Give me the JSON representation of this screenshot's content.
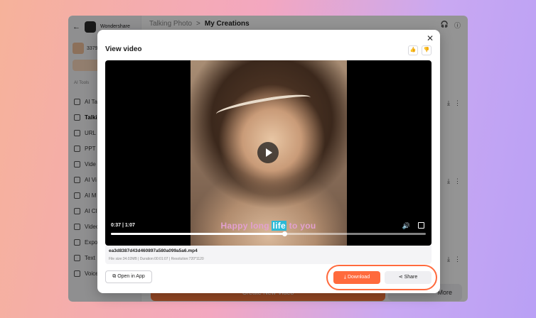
{
  "app": {
    "brand": "Wondershare",
    "credits": "3379",
    "sidebar_section": "AI Tools",
    "sidebar_items": [
      {
        "label": "AI Ta"
      },
      {
        "label": "Talki"
      },
      {
        "label": "URL"
      },
      {
        "label": "PPT"
      },
      {
        "label": "Vide"
      },
      {
        "label": "AI Vi"
      },
      {
        "label": "AI M"
      },
      {
        "label": "AI Cl"
      },
      {
        "label": "Video"
      },
      {
        "label": "Expo"
      },
      {
        "label": "Text"
      },
      {
        "label": "Voice"
      }
    ],
    "breadcrumb": {
      "parent": "Talking Photo",
      "separator": ">",
      "current": "My Creations"
    },
    "more_label": "More",
    "create_label": "Create New Video"
  },
  "modal": {
    "title": "View video",
    "close_glyph": "✕",
    "like_glyph": "👍",
    "dislike_glyph": "👎",
    "player": {
      "current_time": "0:37",
      "separator": "|",
      "duration": "1:07",
      "progress": 0.55,
      "caption_before": "Happy long ",
      "caption_highlight": "life",
      "caption_after": " to you",
      "volume_glyph": "🔊"
    },
    "file": {
      "name": "ea3d8387d43d460897a580a099a5a6.mp4",
      "meta": "File size:34.02MB  |  Duration:00:01:07  |  Resolution:720*1120"
    },
    "buttons": {
      "open_in_app": "Open in App",
      "download": "Download",
      "share": "Share"
    }
  },
  "colors": {
    "accent": "#ff6a3d",
    "caption": "#e3a0d0",
    "caption_highlight": "#2ab9d6"
  }
}
